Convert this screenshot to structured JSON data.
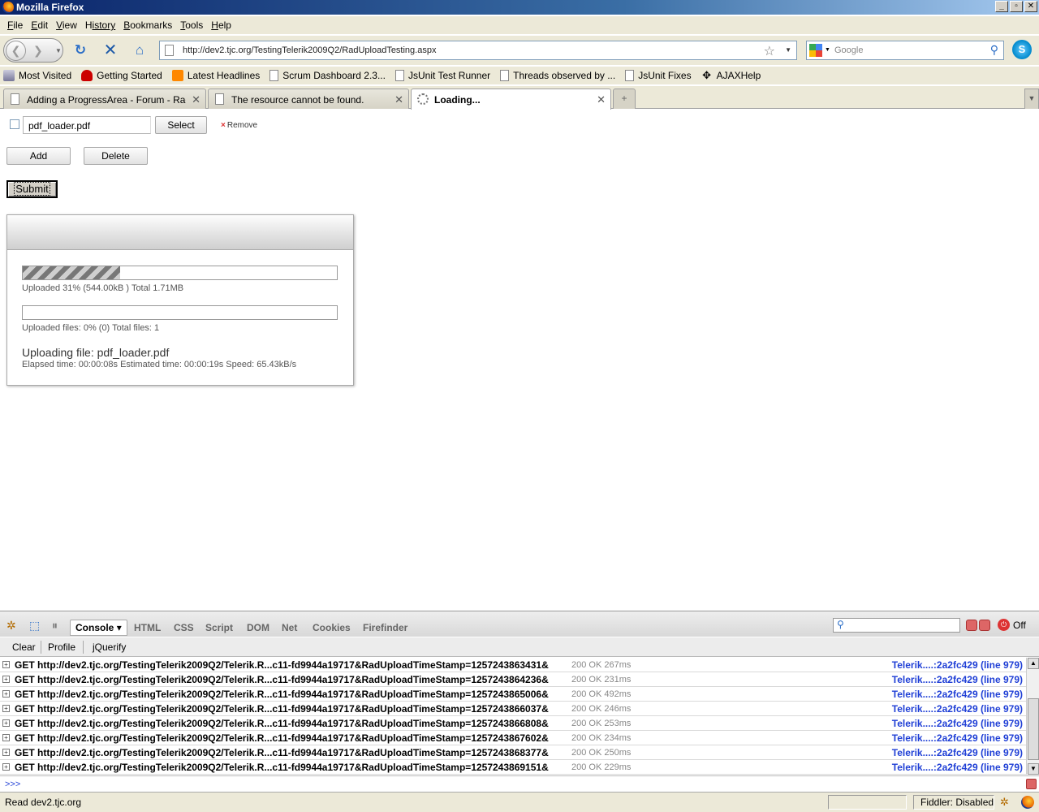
{
  "window": {
    "title": "Mozilla Firefox",
    "buttons": [
      "_",
      "▫",
      "✕"
    ]
  },
  "menu": [
    {
      "key": "F",
      "rest": "ile"
    },
    {
      "key": "E",
      "rest": "dit"
    },
    {
      "key": "V",
      "rest": "iew"
    },
    {
      "key": "H",
      "rest": "istory",
      "pre": ""
    },
    {
      "key": "B",
      "rest": "ookmarks"
    },
    {
      "key": "T",
      "rest": "ools"
    },
    {
      "key": "H",
      "rest": "elp"
    }
  ],
  "nav": {
    "url": "http://dev2.tjc.org/TestingTelerik2009Q2/RadUploadTesting.aspx",
    "search_placeholder": "Google"
  },
  "bookmarks": [
    {
      "label": "Most Visited",
      "icon": "most-visited-icon"
    },
    {
      "label": "Getting Started",
      "icon": "getting-started-icon"
    },
    {
      "label": "Latest Headlines",
      "icon": "rss-icon"
    },
    {
      "label": "Scrum Dashboard 2.3...",
      "icon": "page-icon"
    },
    {
      "label": "JsUnit Test Runner",
      "icon": "page-icon"
    },
    {
      "label": "Threads observed by ...",
      "icon": "page-icon"
    },
    {
      "label": "JsUnit Fixes",
      "icon": "page-icon"
    },
    {
      "label": "AJAXHelp",
      "icon": "ajaxhelp-icon"
    }
  ],
  "tabs": [
    {
      "label": "Adding a ProgressArea - Forum - RadU...",
      "active": false
    },
    {
      "label": "The resource cannot be found.",
      "active": false
    },
    {
      "label": "Loading...",
      "active": true
    }
  ],
  "upload": {
    "file_name": "pdf_loader.pdf",
    "select_label": "Select",
    "remove_label": "Remove",
    "add_label": "Add",
    "delete_label": "Delete",
    "submit_label": "Submit"
  },
  "progress": {
    "primary_percent": 31,
    "primary_text": "Uploaded 31% (544.00kB ) Total 1.71MB",
    "secondary_percent": 0,
    "secondary_text": "Uploaded files: 0% (0) Total files: 1",
    "current_file": "Uploading file: pdf_loader.pdf",
    "time_text": "Elapsed time: 00:00:08s Estimated time: 00:00:19s Speed: 65.43kB/s"
  },
  "firebug": {
    "tabs": [
      "Console",
      "HTML",
      "CSS",
      "Script",
      "DOM",
      "Net",
      "Cookies",
      "Firefinder"
    ],
    "console_dropdown": "▾",
    "sub_buttons": [
      "Clear",
      "Profile",
      "jQuerify"
    ],
    "off_label": "Off",
    "prompt": ">>>",
    "log": [
      {
        "req": "GET http://dev2.tjc.org/TestingTelerik2009Q2/Telerik.R...c11-fd9944a19717&RadUploadTimeStamp=1257243863431&",
        "status": "200 OK 267ms",
        "src": "Telerik....:2a2fc429 (line 979)"
      },
      {
        "req": "GET http://dev2.tjc.org/TestingTelerik2009Q2/Telerik.R...c11-fd9944a19717&RadUploadTimeStamp=1257243864236&",
        "status": "200 OK 231ms",
        "src": "Telerik....:2a2fc429 (line 979)"
      },
      {
        "req": "GET http://dev2.tjc.org/TestingTelerik2009Q2/Telerik.R...c11-fd9944a19717&RadUploadTimeStamp=1257243865006&",
        "status": "200 OK 492ms",
        "src": "Telerik....:2a2fc429 (line 979)"
      },
      {
        "req": "GET http://dev2.tjc.org/TestingTelerik2009Q2/Telerik.R...c11-fd9944a19717&RadUploadTimeStamp=1257243866037&",
        "status": "200 OK 246ms",
        "src": "Telerik....:2a2fc429 (line 979)"
      },
      {
        "req": "GET http://dev2.tjc.org/TestingTelerik2009Q2/Telerik.R...c11-fd9944a19717&RadUploadTimeStamp=1257243866808&",
        "status": "200 OK 253ms",
        "src": "Telerik....:2a2fc429 (line 979)"
      },
      {
        "req": "GET http://dev2.tjc.org/TestingTelerik2009Q2/Telerik.R...c11-fd9944a19717&RadUploadTimeStamp=1257243867602&",
        "status": "200 OK 234ms",
        "src": "Telerik....:2a2fc429 (line 979)"
      },
      {
        "req": "GET http://dev2.tjc.org/TestingTelerik2009Q2/Telerik.R...c11-fd9944a19717&RadUploadTimeStamp=1257243868377&",
        "status": "200 OK 250ms",
        "src": "Telerik....:2a2fc429 (line 979)"
      },
      {
        "req": "GET http://dev2.tjc.org/TestingTelerik2009Q2/Telerik.R...c11-fd9944a19717&RadUploadTimeStamp=1257243869151&",
        "status": "200 OK 229ms",
        "src": "Telerik....:2a2fc429 (line 979)"
      }
    ]
  },
  "status": {
    "text": "Read dev2.tjc.org",
    "fiddler": "Fiddler: Disabled"
  }
}
